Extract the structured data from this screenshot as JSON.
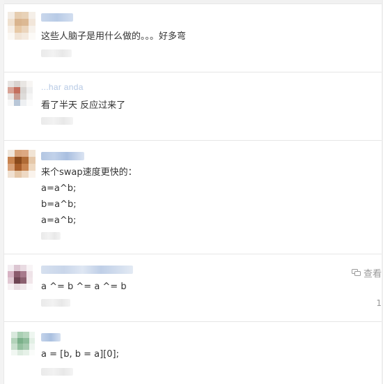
{
  "comments": [
    {
      "content_lines": [
        "这些人脑子是用什么做的。。。好多弯"
      ]
    },
    {
      "username": "...har anda",
      "content_lines": [
        "看了半天 反应过来了"
      ]
    },
    {
      "content_lines": [
        "来个swap速度更快的：",
        "a=a^b;",
        "b=a^b;",
        "a=a^b;"
      ]
    },
    {
      "content_lines": [
        "a ^= b ^= a ^= b"
      ],
      "view_label": "查看",
      "side_count": "1"
    },
    {
      "content_lines": [
        "a = [b, b = a][0];"
      ]
    }
  ]
}
